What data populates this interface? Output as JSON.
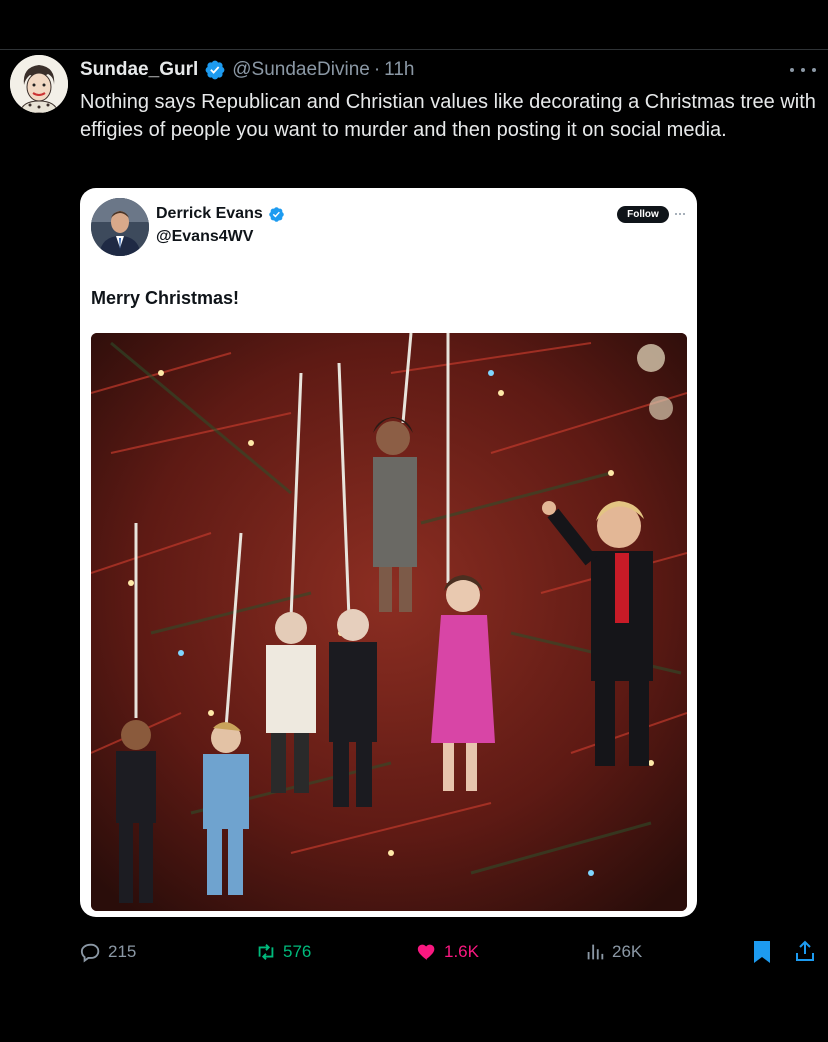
{
  "tweet": {
    "display_name": "Sundae_Gurl",
    "handle": "@SundaeDivine",
    "separator": "·",
    "time": "11h",
    "text": "Nothing says Republican and Christian values like decorating a Christmas tree with effigies of people you want to murder and then posting it on social media."
  },
  "quoted": {
    "display_name": "Derrick Evans",
    "handle": "@Evans4WV",
    "follow_label": "Follow",
    "text": "Merry Christmas!"
  },
  "actions": {
    "replies": "215",
    "retweets": "576",
    "likes": "1.6K",
    "views": "26K"
  },
  "colors": {
    "background": "#000000",
    "verified": "#1d9bf0",
    "retweet": "#00ba7c",
    "like": "#f91880",
    "bookmark": "#1d9bf0",
    "muted": "#8b98a5"
  },
  "icons": [
    "verified-badge-icon",
    "more-icon",
    "reply-icon",
    "retweet-icon",
    "heart-icon",
    "views-icon",
    "bookmark-icon",
    "share-icon"
  ]
}
